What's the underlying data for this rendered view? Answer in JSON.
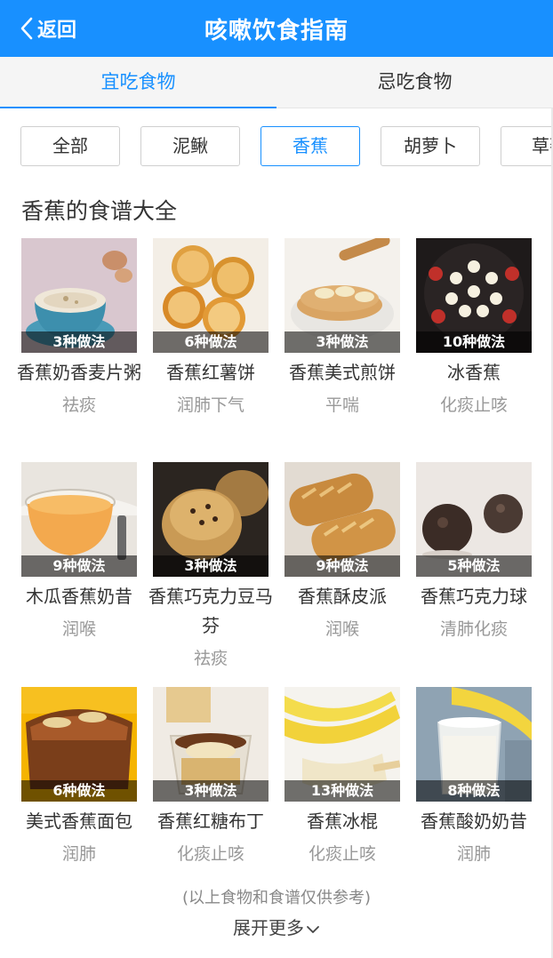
{
  "header": {
    "back_label": "返回",
    "title": "咳嗽饮食指南"
  },
  "tabs": [
    {
      "label": "宜吃食物",
      "active": true
    },
    {
      "label": "忌吃食物",
      "active": false
    }
  ],
  "filters": [
    {
      "label": "全部",
      "active": false
    },
    {
      "label": "泥鳅",
      "active": false
    },
    {
      "label": "香蕉",
      "active": true
    },
    {
      "label": "胡萝卜",
      "active": false
    },
    {
      "label": "草莓",
      "active": false
    }
  ],
  "section_title": "香蕉的食谱大全",
  "recipes": [
    {
      "name": "香蕉奶香麦片粥",
      "badge": "3种做法",
      "effect": "祛痰",
      "icon": "oat-porridge-photo"
    },
    {
      "name": "香蕉红薯饼",
      "badge": "6种做法",
      "effect": "润肺下气",
      "icon": "sesame-cake-photo"
    },
    {
      "name": "香蕉美式煎饼",
      "badge": "3种做法",
      "effect": "平喘",
      "icon": "pancake-photo"
    },
    {
      "name": "冰香蕉",
      "badge": "10种做法",
      "effect": "化痰止咳",
      "icon": "frozen-banana-photo"
    },
    {
      "name": "木瓜香蕉奶昔",
      "badge": "9种做法",
      "effect": "润喉",
      "icon": "smoothie-photo"
    },
    {
      "name": "香蕉巧克力豆马芬",
      "badge": "3种做法",
      "effect": "祛痰",
      "icon": "muffin-photo"
    },
    {
      "name": "香蕉酥皮派",
      "badge": "9种做法",
      "effect": "润喉",
      "icon": "puff-pie-photo"
    },
    {
      "name": "香蕉巧克力球",
      "badge": "5种做法",
      "effect": "清肺化痰",
      "icon": "chocolate-ball-photo"
    },
    {
      "name": "美式香蕉面包",
      "badge": "6种做法",
      "effect": "润肺",
      "icon": "banana-bread-photo"
    },
    {
      "name": "香蕉红糖布丁",
      "badge": "3种做法",
      "effect": "化痰止咳",
      "icon": "pudding-photo"
    },
    {
      "name": "香蕉冰棍",
      "badge": "13种做法",
      "effect": "化痰止咳",
      "icon": "banana-popsicle-photo"
    },
    {
      "name": "香蕉酸奶奶昔",
      "badge": "8种做法",
      "effect": "润肺",
      "icon": "yogurt-shake-photo"
    }
  ],
  "footer": {
    "note": "(以上食物和食谱仅供参考)",
    "more_label": "展开更多"
  },
  "colors": {
    "accent": "#1890ff",
    "muted": "#999999",
    "text": "#333333"
  }
}
